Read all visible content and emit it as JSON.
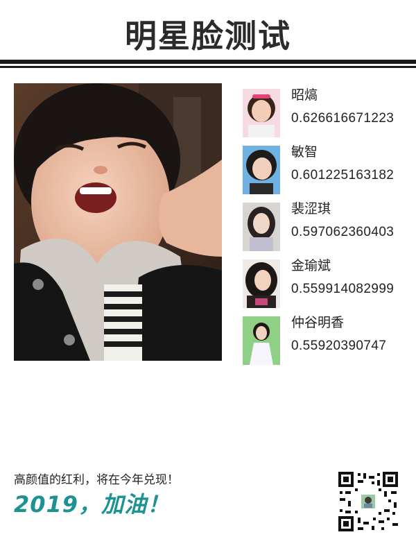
{
  "header": {
    "title": "明星脸测试"
  },
  "main_photo": {
    "alt": "user photo"
  },
  "matches": [
    {
      "name": "昭熇",
      "score": "0.626616671223",
      "thumb_color": "#f2c7cf"
    },
    {
      "name": "敏智",
      "score": "0.601225163182",
      "thumb_color": "#7fb6df"
    },
    {
      "name": "裴涩琪",
      "score": "0.597062360403",
      "thumb_color": "#c9c4c0"
    },
    {
      "name": "金瑜斌",
      "score": "0.559914082999",
      "thumb_color": "#8a6a6a"
    },
    {
      "name": "仲谷明香",
      "score": "0.55920390747",
      "thumb_color": "#9fd09a"
    }
  ],
  "footer": {
    "tagline": "高颜值的红利，将在今年兑现！",
    "slogan": "2019，加油！",
    "slogan_color": "#1e9191"
  },
  "qr": {
    "icon": "qr-code-icon"
  }
}
